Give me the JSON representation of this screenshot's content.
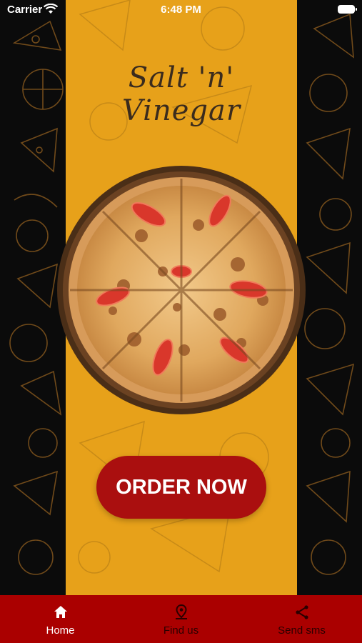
{
  "status_bar": {
    "carrier": "Carrier",
    "time": "6:48 PM"
  },
  "logo_text": "Salt 'n' Vinegar",
  "order_button": {
    "label": "ORDER NOW"
  },
  "tabbar": {
    "items": [
      {
        "label": "Home",
        "icon": "home-icon",
        "active": true
      },
      {
        "label": "Find us",
        "icon": "location-pin-icon",
        "active": false
      },
      {
        "label": "Send sms",
        "icon": "share-icon",
        "active": false
      }
    ]
  },
  "colors": {
    "band": "#E7A11A",
    "button": "#AA0F0F",
    "tabbar": "#AA0000",
    "background": "#0b0b0b"
  }
}
